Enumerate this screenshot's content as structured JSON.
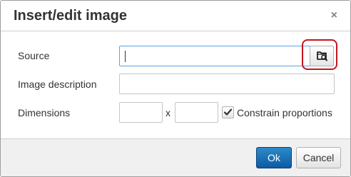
{
  "dialog": {
    "title": "Insert/edit image",
    "close_glyph": "×"
  },
  "form": {
    "source": {
      "label": "Source",
      "value": ""
    },
    "description": {
      "label": "Image description",
      "value": ""
    },
    "dimensions": {
      "label": "Dimensions",
      "width": "",
      "height": "",
      "separator": "x",
      "constrain_label": "Constrain proportions",
      "constrain_checked": true
    },
    "browse_icon": "browse-folder-icon"
  },
  "buttons": {
    "ok": "Ok",
    "cancel": "Cancel"
  },
  "colors": {
    "primary_button": "#1a6fb8",
    "focus_border": "#59a5e5",
    "highlight_annotation": "#c4151c"
  }
}
